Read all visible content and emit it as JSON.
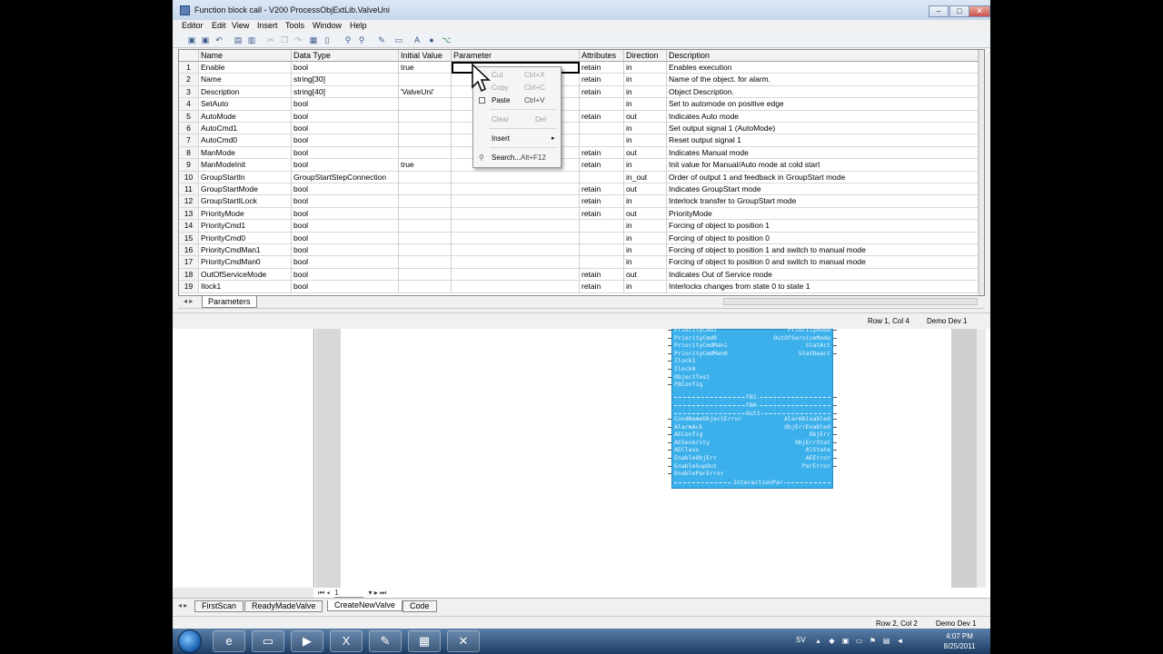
{
  "window": {
    "title": "Function block call - V200 ProcessObjExtLib.ValveUni",
    "controls": {
      "minimize": "‒",
      "maximize": "□",
      "close": "✕"
    }
  },
  "menubar": [
    "Editor",
    "Edit",
    "View",
    "Insert",
    "Tools",
    "Window",
    "Help"
  ],
  "toolbar_icons": [
    "save-icon",
    "save-all-icon",
    "undo-icon",
    "print-icon",
    "print-preview-icon",
    "cut-icon",
    "copy-icon",
    "paste-icon",
    "find-icon",
    "replace-icon",
    "tools-icon",
    "layout-icon",
    "font-icon",
    "link-icon",
    "tree-icon"
  ],
  "grid": {
    "headers": [
      "",
      "Name",
      "Data Type",
      "Initial Value",
      "Parameter",
      "Attributes",
      "Direction",
      "Description"
    ],
    "rows": [
      [
        "1",
        "Enable",
        "bool",
        "true",
        "",
        "retain",
        "in",
        "Enables execution"
      ],
      [
        "2",
        "Name",
        "string[30]",
        "",
        "",
        "retain",
        "in",
        "Name of the object. for alarm."
      ],
      [
        "3",
        "Description",
        "string[40]",
        "'ValveUni'",
        "",
        "retain",
        "in",
        "Object Description."
      ],
      [
        "4",
        "SetAuto",
        "bool",
        "",
        "",
        "",
        "in",
        "Set to automode on positive edge"
      ],
      [
        "5",
        "AutoMode",
        "bool",
        "",
        "",
        "retain",
        "out",
        "Indicates Auto mode"
      ],
      [
        "6",
        "AutoCmd1",
        "bool",
        "",
        "",
        "",
        "in",
        "Set output signal 1 (AutoMode)"
      ],
      [
        "7",
        "AutoCmd0",
        "bool",
        "",
        "",
        "",
        "in",
        "Reset output signal 1"
      ],
      [
        "8",
        "ManMode",
        "bool",
        "",
        "",
        "retain",
        "out",
        "Indicates Manual mode"
      ],
      [
        "9",
        "ManModeInit",
        "bool",
        "true",
        "",
        "retain",
        "in",
        "Init value for Manual/Auto mode at cold start"
      ],
      [
        "10",
        "GroupStartIn",
        "GroupStartStepConnection",
        "",
        "",
        "",
        "in_out",
        "Order of output 1 and feedback in GroupStart mode"
      ],
      [
        "11",
        "GroupStartMode",
        "bool",
        "",
        "",
        "retain",
        "out",
        "Indicates GroupStart mode"
      ],
      [
        "12",
        "GroupStartILock",
        "bool",
        "",
        "",
        "retain",
        "in",
        "Interlock transfer to GroupStart mode"
      ],
      [
        "13",
        "PriorityMode",
        "bool",
        "",
        "",
        "retain",
        "out",
        "PriorityMode"
      ],
      [
        "14",
        "PriorityCmd1",
        "bool",
        "",
        "",
        "",
        "in",
        "Forcing of object to position 1"
      ],
      [
        "15",
        "PriorityCmd0",
        "bool",
        "",
        "",
        "",
        "in",
        "Forcing of object to position 0"
      ],
      [
        "16",
        "PriorityCmdMan1",
        "bool",
        "",
        "",
        "",
        "in",
        "Forcing of object to position 1 and switch to manual mode"
      ],
      [
        "17",
        "PriorityCmdMan0",
        "bool",
        "",
        "",
        "",
        "in",
        "Forcing of object to position 0 and switch to manual mode"
      ],
      [
        "18",
        "OutOfServiceMode",
        "bool",
        "",
        "",
        "retain",
        "out",
        "Indicates Out of Service mode"
      ],
      [
        "19",
        "Ilock1",
        "bool",
        "",
        "",
        "retain",
        "in",
        "Interlocks changes from state 0 to state 1"
      ]
    ]
  },
  "grid_tab": "Parameters",
  "status_top": {
    "position": "Row 1, Col 4",
    "user": "Demo Dev 1"
  },
  "context_menu": [
    {
      "label": "Cut",
      "shortcut": "Ctrl+X",
      "enabled": false
    },
    {
      "label": "Copy",
      "shortcut": "Ctrl+C",
      "enabled": false
    },
    {
      "label": "Paste",
      "shortcut": "Ctrl+V",
      "enabled": true
    },
    {
      "label": "Clear",
      "shortcut": "Del",
      "enabled": false
    },
    {
      "label": "Insert",
      "shortcut": "",
      "enabled": true
    },
    {
      "label": "Search...",
      "shortcut": "Alt+F12",
      "enabled": true
    }
  ],
  "function_block": {
    "left_pins": [
      "PriorityCmd1",
      "PriorityCmd0",
      "PriorityCmdMan1",
      "PriorityCmdMan0",
      "Ilock1",
      "Ilock0",
      "ObjectTest",
      "FBConfig"
    ],
    "right_pins": [
      "PriorityMode",
      "OutOfServiceMode",
      "StatAct",
      "StatDeact"
    ],
    "section_fb1": "FB1",
    "section_fb0": "FB0",
    "section_out1": "Out1",
    "left_pins2": [
      "CondNameObjectError",
      "AlarmAck",
      "AEConfig",
      "AESeverity",
      "AEClass",
      "EnableObjErr",
      "EnableSupOut",
      "EnableParError"
    ],
    "right_pins2": [
      "AlarmDisabled",
      "ObjErrEnabled",
      "ObjErr",
      "ObjErrStat",
      "AlState",
      "AEError",
      "ParError"
    ],
    "section_interaction": "InteractionPar"
  },
  "page_nav": {
    "page": "1"
  },
  "bottom_tabs": [
    "FirstScan",
    "ReadyMadeValve",
    "CreateNewValve",
    "Code"
  ],
  "bottom_tab_active": "CreateNewValve",
  "status_bottom": {
    "position": "Row 2, Col 2",
    "user": "Demo Dev 1"
  },
  "taskbar": {
    "apps": [
      "ie-icon",
      "explorer-icon",
      "media-player-icon",
      "excel-icon",
      "control-builder-icon",
      "film-icon",
      "tools-icon"
    ],
    "tray_lang": "SV",
    "time": "4:07 PM",
    "date": "8/25/2011"
  }
}
